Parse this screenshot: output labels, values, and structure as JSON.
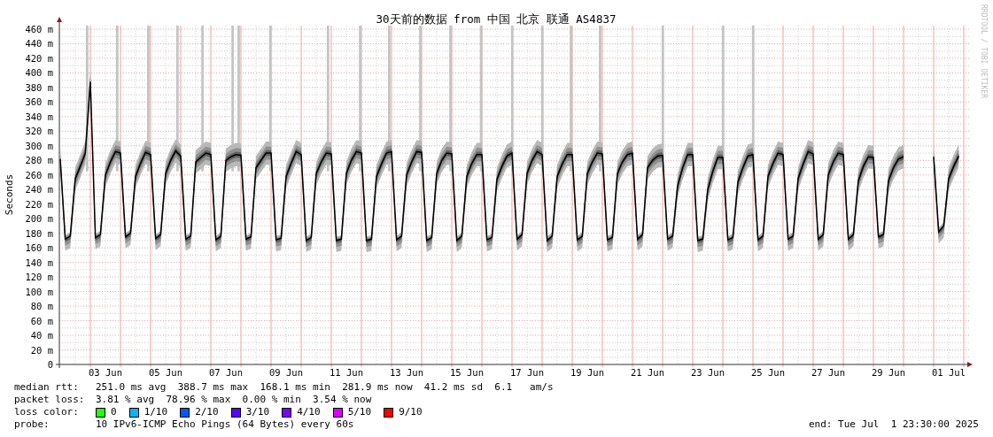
{
  "graph": {
    "watermark": "RRDTOOL / TOBI OETIKER",
    "chart_data": {
      "type": "line",
      "title": "30天前的数据 from 中国 北京 联通 AS4837",
      "ylabel": "Seconds",
      "ylim": [
        0,
        465
      ],
      "yticks": [
        {
          "value": 0,
          "label": "0"
        },
        {
          "value": 20,
          "label": "20 m"
        },
        {
          "value": 40,
          "label": "40 m"
        },
        {
          "value": 60,
          "label": "60 m"
        },
        {
          "value": 80,
          "label": "80 m"
        },
        {
          "value": 100,
          "label": "100 m"
        },
        {
          "value": 120,
          "label": "120 m"
        },
        {
          "value": 140,
          "label": "140 m"
        },
        {
          "value": 160,
          "label": "160 m"
        },
        {
          "value": 180,
          "label": "180 m"
        },
        {
          "value": 200,
          "label": "200 m"
        },
        {
          "value": 220,
          "label": "220 m"
        },
        {
          "value": 240,
          "label": "240 m"
        },
        {
          "value": 260,
          "label": "260 m"
        },
        {
          "value": 280,
          "label": "280 m"
        },
        {
          "value": 300,
          "label": "300 m"
        },
        {
          "value": 320,
          "label": "320 m"
        },
        {
          "value": 340,
          "label": "340 m"
        },
        {
          "value": 360,
          "label": "360 m"
        },
        {
          "value": 380,
          "label": "380 m"
        },
        {
          "value": 400,
          "label": "400 m"
        },
        {
          "value": 420,
          "label": "420 m"
        },
        {
          "value": 440,
          "label": "440 m"
        },
        {
          "value": 460,
          "label": "460 m"
        }
      ],
      "categories": [
        null,
        null,
        null,
        null,
        null,
        null,
        null,
        null,
        null,
        "03 Jun",
        null,
        null,
        null,
        null,
        null,
        null,
        null,
        null,
        null,
        null,
        null,
        "05 Jun",
        null,
        null,
        null,
        null,
        null,
        null,
        null,
        null,
        null,
        null,
        null,
        "07 Jun",
        null,
        null,
        null,
        null,
        null,
        null,
        null,
        null,
        null,
        null,
        null,
        "09 Jun",
        null,
        null,
        null,
        null,
        null,
        null,
        null,
        null,
        null,
        null,
        null,
        "11 Jun",
        null,
        null,
        null,
        null,
        null,
        null,
        null,
        null,
        null,
        null,
        null,
        "13 Jun",
        null,
        null,
        null,
        null,
        null,
        null,
        null,
        null,
        null,
        null,
        null,
        "15 Jun",
        null,
        null,
        null,
        null,
        null,
        null,
        null,
        null,
        null,
        null,
        null,
        "17 Jun",
        null,
        null,
        null,
        null,
        null,
        null,
        null,
        null,
        null,
        null,
        null,
        "19 Jun",
        null,
        null,
        null,
        null,
        null,
        null,
        null,
        null,
        null,
        null,
        null,
        "21 Jun",
        null,
        null,
        null,
        null,
        null,
        null,
        null,
        null,
        null,
        null,
        null,
        "23 Jun",
        null,
        null,
        null,
        null,
        null,
        null,
        null,
        null,
        null,
        null,
        null,
        "25 Jun",
        null,
        null,
        null,
        null,
        null,
        null,
        null,
        null,
        null,
        null,
        null,
        "27 Jun",
        null,
        null,
        null,
        null,
        null,
        null,
        null,
        null,
        null,
        null,
        null,
        "29 Jun",
        null,
        null,
        null,
        null,
        null,
        null,
        null,
        null,
        null,
        null,
        null,
        "01 Jul",
        null,
        null
      ],
      "series": [
        {
          "name": "median rtt:",
          "color": "#000000",
          "values": [
            282,
            172,
            176,
            255,
            272,
            290,
            388,
            174,
            178,
            260,
            278,
            292,
            290,
            175,
            180,
            258,
            276,
            291,
            288,
            173,
            178,
            262,
            280,
            293,
            286,
            172,
            176,
            278,
            284,
            290,
            288,
            171,
            176,
            280,
            285,
            288,
            287,
            172,
            175,
            270,
            280,
            290,
            290,
            171,
            173,
            258,
            276,
            292,
            288,
            170,
            174,
            262,
            278,
            290,
            289,
            170,
            172,
            262,
            280,
            292,
            290,
            170,
            172,
            258,
            275,
            290,
            292,
            171,
            176,
            260,
            278,
            292,
            291,
            170,
            174,
            262,
            280,
            290,
            289,
            170,
            176,
            258,
            276,
            288,
            288,
            171,
            174,
            254,
            272,
            286,
            290,
            172,
            178,
            262,
            280,
            292,
            288,
            170,
            176,
            258,
            275,
            288,
            288,
            171,
            176,
            262,
            278,
            290,
            289,
            171,
            174,
            262,
            278,
            288,
            290,
            172,
            178,
            270,
            280,
            286,
            287,
            172,
            176,
            245,
            270,
            288,
            288,
            170,
            172,
            240,
            265,
            284,
            284,
            171,
            174,
            250,
            270,
            286,
            288,
            171,
            176,
            258,
            276,
            290,
            288,
            172,
            176,
            255,
            275,
            292,
            289,
            172,
            178,
            260,
            278,
            290,
            288,
            172,
            178,
            252,
            272,
            285,
            284,
            175,
            178,
            252,
            270,
            282,
            285,
            null,
            null,
            null,
            null,
            null,
            285,
            182,
            190,
            255,
            272,
            286
          ]
        }
      ],
      "grid": true
    }
  },
  "legend": {
    "median_rtt": {
      "text": "251.0 ms avg  388.7 ms max  168.1 ms min  281.9 ms now  41.2 ms sd  6.1   am/s"
    },
    "packet_loss": {
      "label": "packet loss:",
      "text": "3.81 % avg  78.96 % max  0.00 % min  3.54 % now"
    },
    "loss_color": {
      "label": "loss color:",
      "items": [
        {
          "label": "0",
          "color": "#26ff00"
        },
        {
          "label": "1/10",
          "color": "#00b8ff"
        },
        {
          "label": "2/10",
          "color": "#0059ff"
        },
        {
          "label": "3/10",
          "color": "#5e00ff"
        },
        {
          "label": "4/10",
          "color": "#7e00ff"
        },
        {
          "label": "5/10",
          "color": "#dd00ff"
        },
        {
          "label": "9/10",
          "color": "#ff0000"
        }
      ]
    },
    "probe": {
      "label": "probe:",
      "text": "10 IPv6-ICMP Echo Pings (64 Bytes) every 60s"
    },
    "end": "end: Tue Jul  1 23:30:00 2025"
  }
}
